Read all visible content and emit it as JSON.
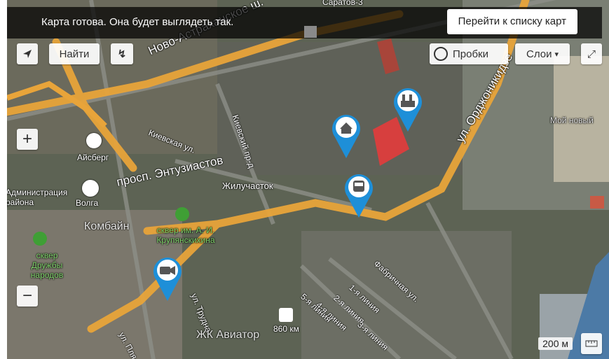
{
  "topbar": {
    "message": "Карта готова. Она будет выглядеть так.",
    "go_to_list": "Перейти к списку карт"
  },
  "controls": {
    "find": "Найти",
    "traffic": "Пробки",
    "layers": "Слои",
    "zoom_in": "+",
    "zoom_out": "−"
  },
  "map_labels": {
    "street_1": "Ново-Астраханское ш.",
    "street_2": "просп. Энтузиастов",
    "street_3": "Киевская ул.",
    "street_4": "Киевский пр-д",
    "street_5": "ул. Орджоникидзе",
    "street_6": "Фабричная ул.",
    "street_7": "1-я линия",
    "street_8": "2-я линия",
    "street_9": "3-я линия",
    "street_10": "4-я линия",
    "street_11": "5-я линия",
    "street_12": "ул. Трудна",
    "street_13": "ул. Пля",
    "street_14": "Саратов-3",
    "district": "Жилучасток",
    "aisberg": "Айсберг",
    "volga": "Волга",
    "kombain": "Комбайн",
    "park_1": "сквер им. А. И. Крупянскихина",
    "park_2": "сквер Дружбы народов",
    "admin": "Администрация района",
    "station": "860 км",
    "zhk": "ЖК Авиатор",
    "my_house": "Мой новый"
  },
  "scale": {
    "label": "200 м"
  },
  "markers": [
    {
      "icon": "house-icon"
    },
    {
      "icon": "factory-icon"
    },
    {
      "icon": "train-icon"
    },
    {
      "icon": "camera-icon"
    }
  ],
  "colors": {
    "road": "#e8a43a",
    "marker": "#1e8fd8",
    "highlight": "#e83a3a"
  }
}
